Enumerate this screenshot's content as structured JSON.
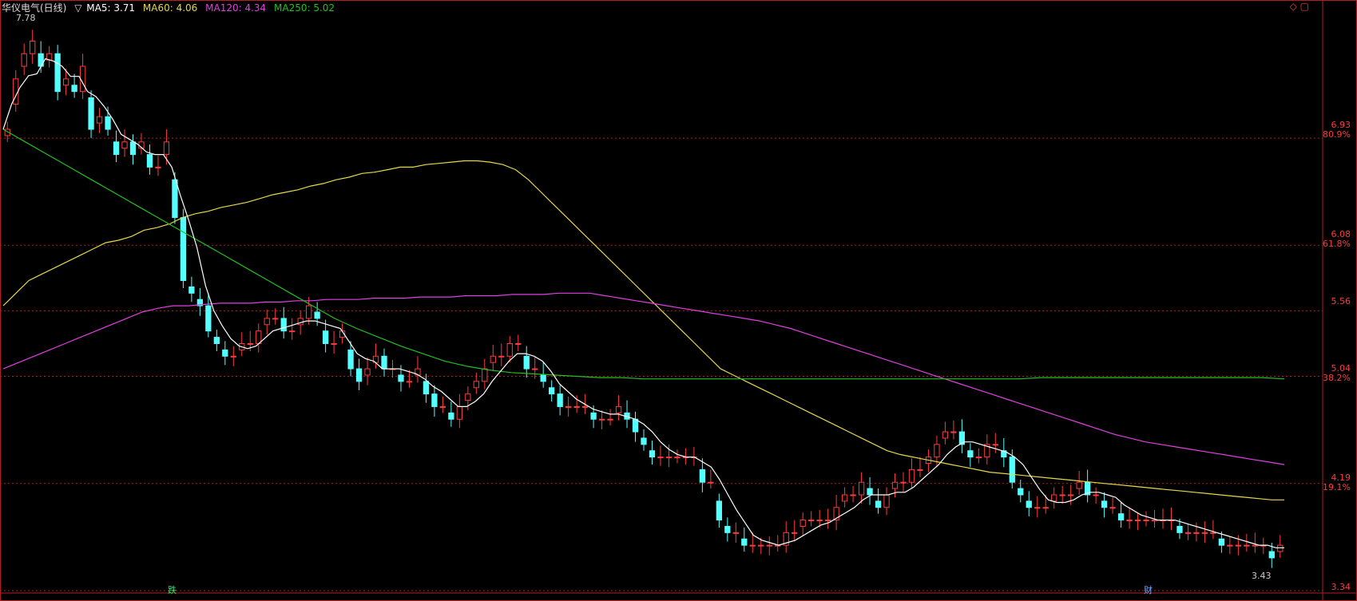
{
  "header": {
    "stock": "华仪电气(日线)",
    "dropdown": "▽",
    "ma5": "MA5: 3.71",
    "ma60": "MA60: 4.06",
    "ma120": "MA120: 4.34",
    "ma250": "MA250: 5.02"
  },
  "colors": {
    "background": "#000000",
    "up": "#ff3b3b",
    "down": "#54ffff",
    "ma5": "#ffffff",
    "ma60": "#e6d84a",
    "ma120": "#e040e0",
    "ma250": "#22c022",
    "grid": "#b02020"
  },
  "chart_data": {
    "type": "candlestick",
    "y_range": [
      3.34,
      7.95
    ],
    "price_levels": [
      "6.93",
      "6.08",
      "5.56",
      "5.04",
      "4.19",
      "3.34"
    ],
    "pct_levels": [
      "80.9%",
      "61.8%",
      "38.2%",
      "19.1%"
    ],
    "high_label": "7.78",
    "low_label": "3.43",
    "markers": [
      "跌",
      "财"
    ],
    "close": [
      7.0,
      7.4,
      7.6,
      7.7,
      7.5,
      7.6,
      7.3,
      7.4,
      7.3,
      7.5,
      7.0,
      7.1,
      7.0,
      6.8,
      6.9,
      6.8,
      6.9,
      6.7,
      6.7,
      6.9,
      6.3,
      5.8,
      5.7,
      5.6,
      5.4,
      5.3,
      5.2,
      5.2,
      5.3,
      5.3,
      5.4,
      5.5,
      5.5,
      5.4,
      5.4,
      5.5,
      5.6,
      5.5,
      5.3,
      5.3,
      5.4,
      5.1,
      5.0,
      5.1,
      5.2,
      5.1,
      5.1,
      5.0,
      5.0,
      5.1,
      4.9,
      4.8,
      4.8,
      4.7,
      4.8,
      4.9,
      5.0,
      5.1,
      5.2,
      5.2,
      5.3,
      5.3,
      5.1,
      5.1,
      5.0,
      4.9,
      4.8,
      4.8,
      4.8,
      4.8,
      4.7,
      4.7,
      4.7,
      4.8,
      4.7,
      4.6,
      4.5,
      4.4,
      4.4,
      4.4,
      4.4,
      4.4,
      4.4,
      4.2,
      4.2,
      3.9,
      3.8,
      3.8,
      3.7,
      3.7,
      3.7,
      3.7,
      3.7,
      3.8,
      3.8,
      3.9,
      3.9,
      3.9,
      3.9,
      4.0,
      4.1,
      4.1,
      4.2,
      4.1,
      4.0,
      4.1,
      4.2,
      4.2,
      4.3,
      4.3,
      4.4,
      4.5,
      4.6,
      4.6,
      4.5,
      4.4,
      4.4,
      4.5,
      4.5,
      4.4,
      4.2,
      4.1,
      4.0,
      4.0,
      4.0,
      4.1,
      4.1,
      4.1,
      4.2,
      4.1,
      4.1,
      4.0,
      4.0,
      3.9,
      3.9,
      3.9,
      3.9,
      3.9,
      3.9,
      3.9,
      3.8,
      3.8,
      3.8,
      3.8,
      3.8,
      3.7,
      3.7,
      3.7,
      3.7,
      3.7,
      3.7,
      3.6,
      3.7
    ],
    "ma60": [
      5.6,
      5.7,
      5.8,
      5.85,
      5.9,
      5.95,
      6.0,
      6.05,
      6.1,
      6.12,
      6.15,
      6.2,
      6.22,
      6.25,
      6.3,
      6.33,
      6.35,
      6.38,
      6.4,
      6.42,
      6.45,
      6.48,
      6.5,
      6.52,
      6.55,
      6.57,
      6.6,
      6.62,
      6.65,
      6.66,
      6.68,
      6.7,
      6.7,
      6.72,
      6.73,
      6.74,
      6.75,
      6.75,
      6.74,
      6.72,
      6.68,
      6.6,
      6.5,
      6.4,
      6.3,
      6.2,
      6.1,
      6.0,
      5.9,
      5.8,
      5.7,
      5.6,
      5.5,
      5.4,
      5.3,
      5.2,
      5.1,
      5.05,
      5.0,
      4.95,
      4.9,
      4.85,
      4.8,
      4.75,
      4.7,
      4.65,
      4.6,
      4.55,
      4.5,
      4.45,
      4.42,
      4.4,
      4.38,
      4.36,
      4.34,
      4.32,
      4.3,
      4.28,
      4.27,
      4.26,
      4.25,
      4.24,
      4.23,
      4.22,
      4.21,
      4.2,
      4.19,
      4.18,
      4.17,
      4.16,
      4.15,
      4.14,
      4.13,
      4.12,
      4.11,
      4.1,
      4.09,
      4.08,
      4.07,
      4.06,
      4.06
    ],
    "ma120": [
      5.1,
      5.15,
      5.2,
      5.25,
      5.3,
      5.35,
      5.4,
      5.45,
      5.5,
      5.55,
      5.58,
      5.6,
      5.6,
      5.61,
      5.62,
      5.62,
      5.62,
      5.63,
      5.63,
      5.64,
      5.64,
      5.65,
      5.65,
      5.65,
      5.66,
      5.66,
      5.66,
      5.67,
      5.67,
      5.67,
      5.68,
      5.68,
      5.68,
      5.69,
      5.69,
      5.69,
      5.7,
      5.7,
      5.7,
      5.68,
      5.66,
      5.64,
      5.62,
      5.6,
      5.58,
      5.56,
      5.54,
      5.52,
      5.5,
      5.48,
      5.45,
      5.42,
      5.38,
      5.34,
      5.3,
      5.26,
      5.22,
      5.18,
      5.14,
      5.1,
      5.06,
      5.02,
      4.98,
      4.94,
      4.9,
      4.86,
      4.82,
      4.78,
      4.74,
      4.7,
      4.66,
      4.62,
      4.58,
      4.55,
      4.52,
      4.5,
      4.48,
      4.46,
      4.44,
      4.42,
      4.4,
      4.38,
      4.36,
      4.34
    ],
    "ma250": [
      7.0,
      6.9,
      6.8,
      6.7,
      6.6,
      6.5,
      6.4,
      6.3,
      6.2,
      6.1,
      6.0,
      5.9,
      5.8,
      5.7,
      5.6,
      5.5,
      5.42,
      5.35,
      5.28,
      5.22,
      5.16,
      5.12,
      5.09,
      5.07,
      5.06,
      5.05,
      5.04,
      5.03,
      5.03,
      5.02,
      5.02,
      5.02,
      5.02,
      5.02,
      5.02,
      5.02,
      5.02,
      5.02,
      5.02,
      5.02,
      5.02,
      5.02,
      5.02,
      5.02,
      5.02,
      5.02,
      5.02,
      5.03,
      5.03,
      5.03,
      5.03,
      5.03,
      5.03,
      5.03,
      5.03,
      5.03,
      5.03,
      5.03,
      5.02
    ]
  }
}
